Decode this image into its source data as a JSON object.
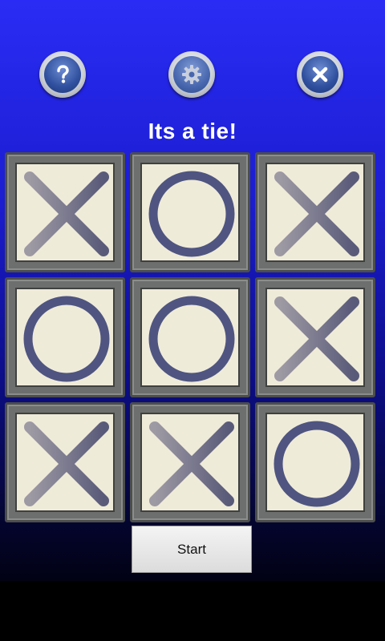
{
  "status_text": "Its a tie!",
  "toolbar": {
    "help_icon": "question-mark-icon",
    "settings_icon": "gear-icon",
    "close_icon": "close-icon"
  },
  "board": {
    "cells": [
      [
        "X",
        "O",
        "X"
      ],
      [
        "O",
        "O",
        "X"
      ],
      [
        "X",
        "X",
        "O"
      ]
    ]
  },
  "start_button_label": "Start",
  "colors": {
    "background_top": "#2a2cf5",
    "background_bottom": "#020214",
    "cell_face": "#efebd9",
    "cell_frame": "#6c6f6d",
    "mark": "#4f5580"
  }
}
